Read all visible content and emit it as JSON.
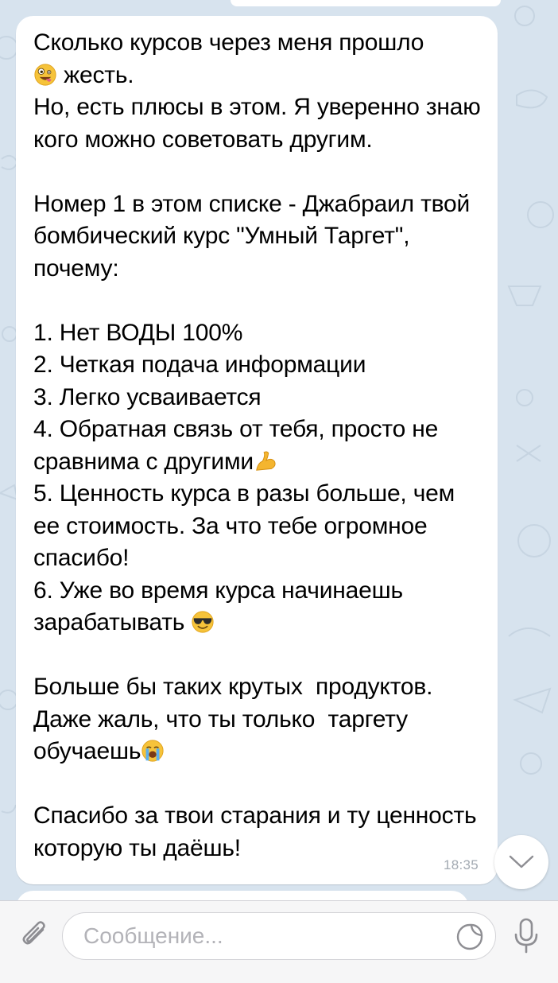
{
  "message": {
    "text": {
      "intro_a": "Сколько курсов через меня прошло\n",
      "intro_b": " жесть.\nНо, есть плюсы в этом. Я уверенно знаю кого можно советовать другим.\n\nНомер 1 в этом списке - Джабраил твой бомбический курс \"Умный Таргет\", почему:\n\n1. Нет ВОДЫ 100%\n2. Четкая подача информации\n3. Легко усваивается\n4. Обратная связь от тебя, просто не сравнима с другими",
      "part_c": "\n5. Ценность курса в разы больше, чем ее стоимость. За что тебе огромное спасибо!\n6. Уже во время курса начинаешь зарабатывать ",
      "part_d": "\n\nБольше бы таких крутых  продуктов. Даже жаль, что ты только  таргету обучаешь",
      "part_e": "\n\nСпасибо за твои старания и ту ценность которую ты даёшь!"
    },
    "emojis": [
      "zany-face",
      "flexed-biceps",
      "smiling-face-with-sunglasses",
      "loudly-crying-face"
    ],
    "time": "18:35"
  },
  "input": {
    "placeholder": "Сообщение..."
  },
  "colors": {
    "background": "#d7e3ee",
    "bubble": "#ffffff",
    "icon": "#8e8e93",
    "time": "#a3aab2"
  }
}
